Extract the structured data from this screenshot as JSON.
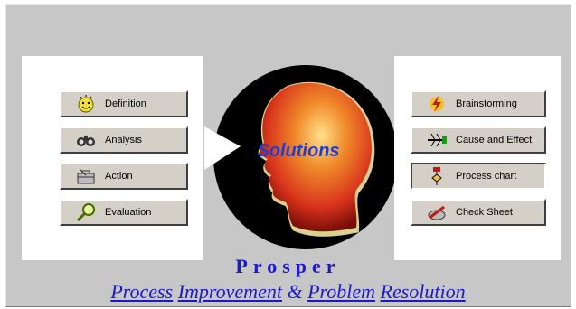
{
  "left_steps": [
    {
      "label": "Definition",
      "icon": "smiley-face-icon"
    },
    {
      "label": "Analysis",
      "icon": "binoculars-icon"
    },
    {
      "label": "Action",
      "icon": "toolbox-icon"
    },
    {
      "label": "Evaluation",
      "icon": "magnifier-icon"
    }
  ],
  "tools": [
    {
      "label": "Brainstorming",
      "icon": "lightning-bolt-icon"
    },
    {
      "label": "Cause and Effect",
      "icon": "fishbone-icon"
    },
    {
      "label": "Process chart",
      "icon": "flowchart-icon"
    },
    {
      "label": "Check Sheet",
      "icon": "pencil-sheet-icon"
    }
  ],
  "logo_text": "Solutions",
  "app_name": "Prosper",
  "tagline": {
    "w1": "Process",
    "w2": "Improvement",
    "amp": "&",
    "w3": "Problem",
    "w4": "Resolution"
  },
  "colors": {
    "title_blue": "#1a1ac8",
    "head_red": "#d8321c",
    "logo_blue": "#1f3fd0"
  }
}
